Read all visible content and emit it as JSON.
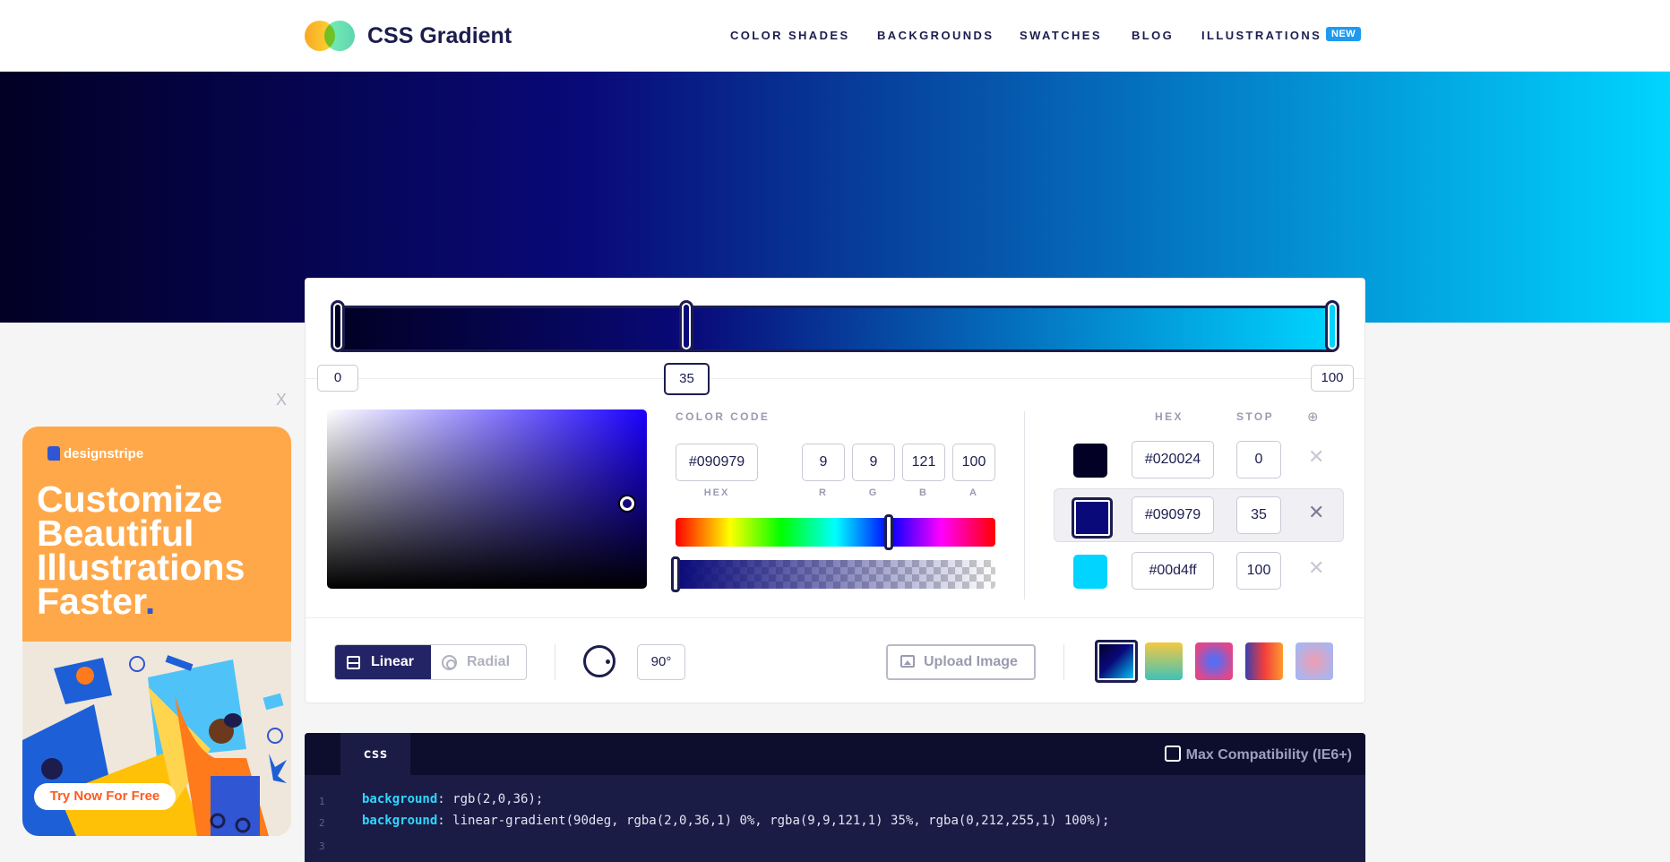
{
  "header": {
    "brand": "CSS Gradient",
    "nav": [
      {
        "label": "COLOR SHADES"
      },
      {
        "label": "BACKGROUNDS"
      },
      {
        "label": "SWATCHES"
      },
      {
        "label": "BLOG"
      },
      {
        "label": "ILLUSTRATIONS"
      }
    ],
    "new_badge": "NEW"
  },
  "gradient": {
    "stops": [
      {
        "hex": "#020024",
        "stop": "0"
      },
      {
        "hex": "#090979",
        "stop": "35"
      },
      {
        "hex": "#00d4ff",
        "stop": "100"
      }
    ],
    "active_stop": 1
  },
  "picker": {
    "color_code_label": "COLOR CODE",
    "hex": "#090979",
    "r": "9",
    "g": "9",
    "b": "121",
    "a": "100",
    "labels": {
      "hex": "HEX",
      "r": "R",
      "g": "G",
      "b": "B",
      "a": "A"
    }
  },
  "stops_panel": {
    "hex_header": "HEX",
    "stop_header": "STOP",
    "add_icon": "⊕",
    "remove_icon": "✕"
  },
  "controls": {
    "linear_label": "Linear",
    "radial_label": "Radial",
    "angle": "90°",
    "upload_label": "Upload Image",
    "presets": [
      "linear-gradient(135deg,#020024,#090979 45%,#00d4ff)",
      "linear-gradient(180deg,#f5c842,#3fc2b8)",
      "radial-gradient(circle,#5a6cf0 15%,#e0478a 75%)",
      "linear-gradient(90deg,#3b3fb0,#f23d3d 50%,#ff9a2e)",
      "radial-gradient(circle,#e8a0b8 10%,#a9b5f0 80%)"
    ]
  },
  "code": {
    "tab": "css",
    "max_compat": "Max Compatibility (IE6+)",
    "lines": [
      {
        "num": "1",
        "prop": "background",
        "value": ": rgb(2,0,36);"
      },
      {
        "num": "2",
        "prop": "background",
        "value": ": linear-gradient(90deg, rgba(2,0,36,1) 0%, rgba(9,9,121,1) 35%, rgba(0,212,255,1) 100%);"
      },
      {
        "num": "3",
        "prop": "",
        "value": ""
      }
    ]
  },
  "ad": {
    "close": "X",
    "brand": "designstripe",
    "title": "Customize Beautiful Illustrations Faster",
    "dot": ".",
    "cta": "Try Now For Free"
  },
  "colors": {
    "navy": "#1c1d4e",
    "accent": "#00d4ff",
    "badge": "#1e9bf0"
  }
}
